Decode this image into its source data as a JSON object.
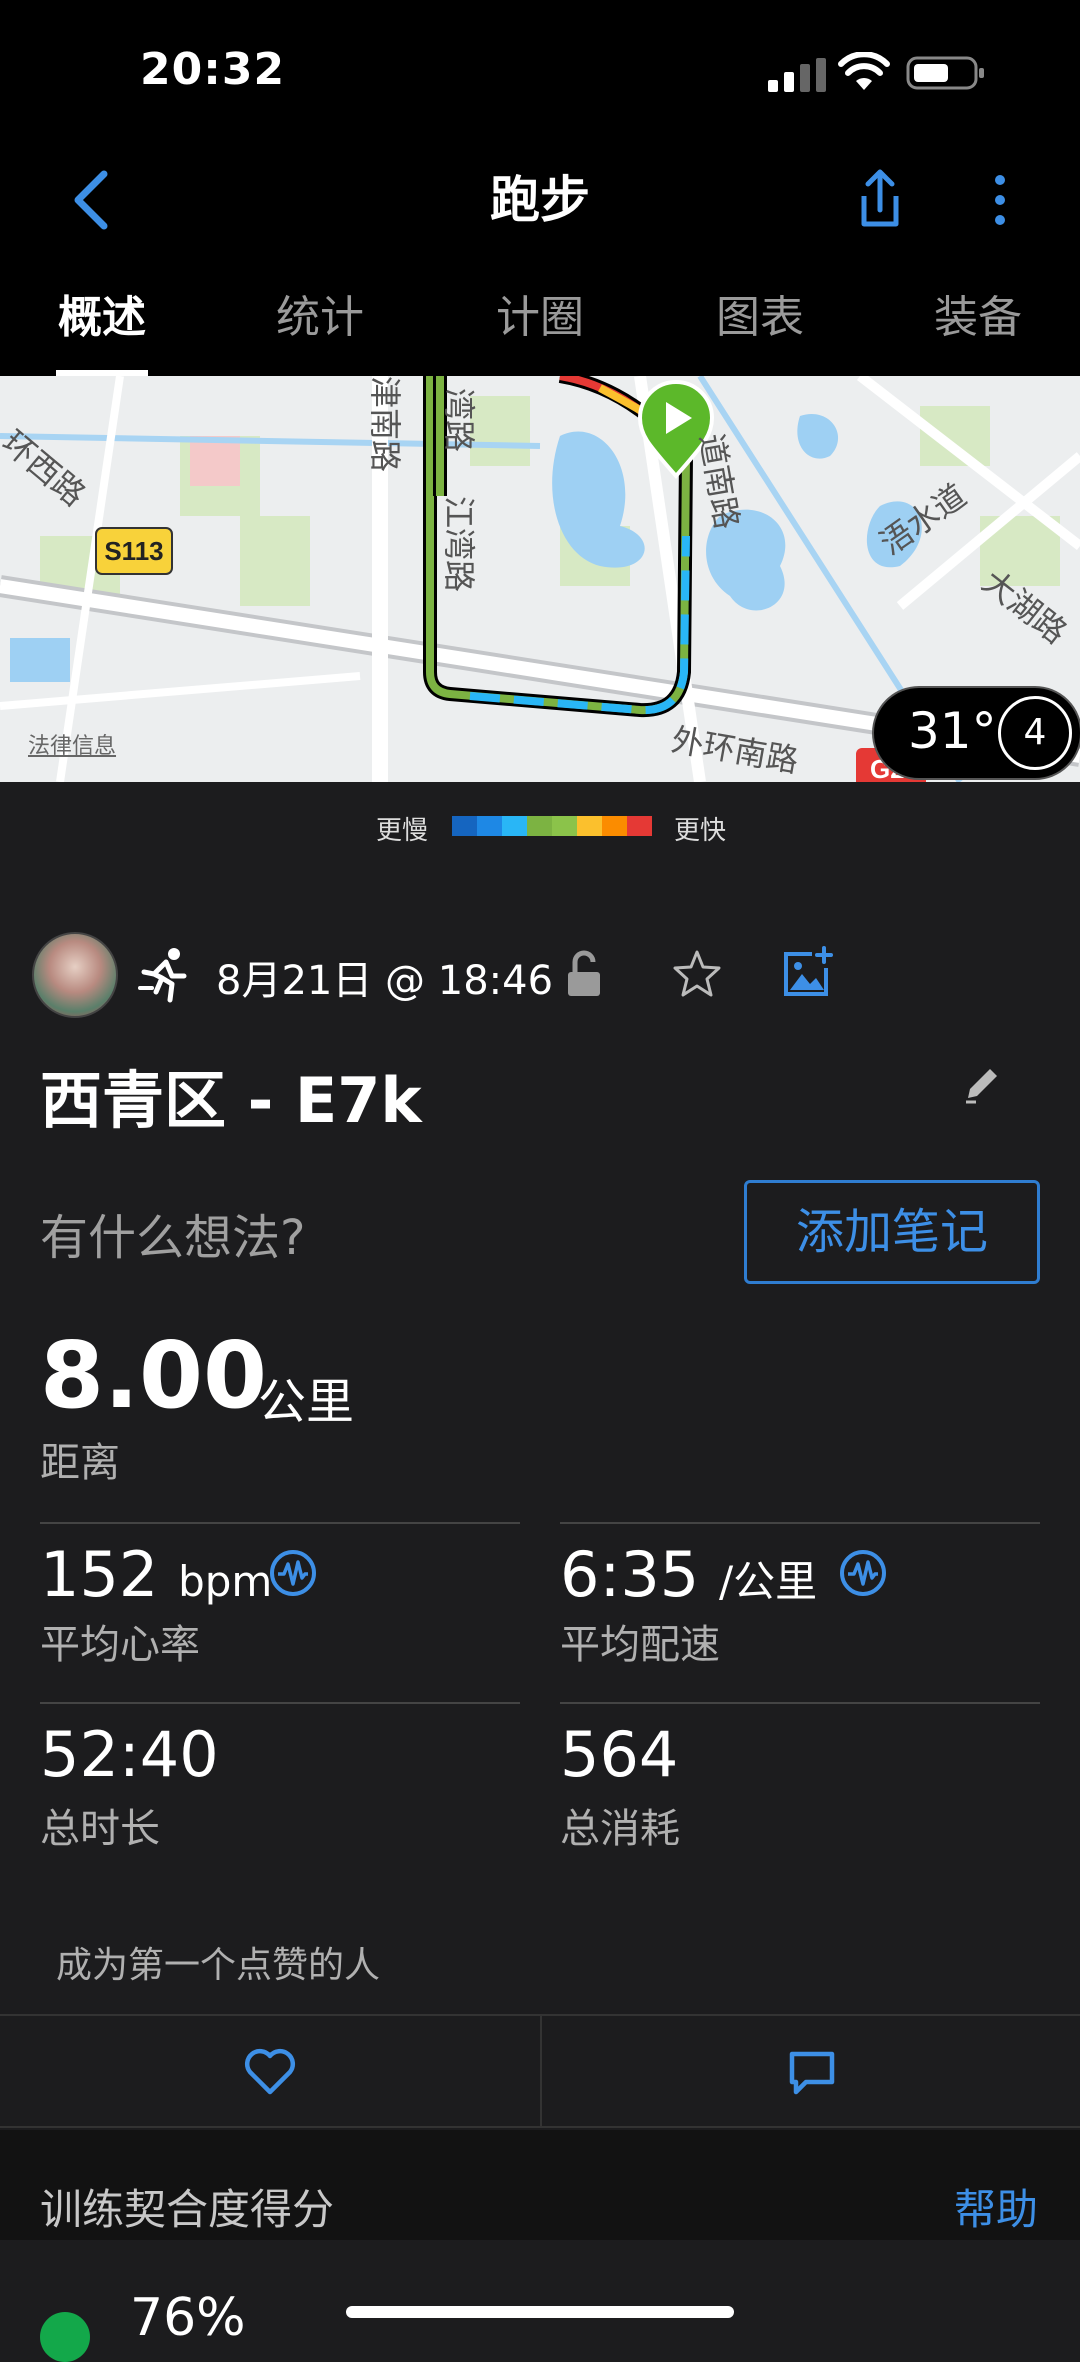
{
  "status_bar": {
    "time": "20:32"
  },
  "nav": {
    "title": "跑步",
    "back_icon": "chevron-left-icon",
    "share_icon": "share-icon",
    "more_icon": "more-vertical-icon"
  },
  "tabs": [
    {
      "label": "概述",
      "active": true
    },
    {
      "label": "统计",
      "active": false
    },
    {
      "label": "计圈",
      "active": false
    },
    {
      "label": "图表",
      "active": false
    },
    {
      "label": "装备",
      "active": false
    }
  ],
  "map": {
    "roads": [
      "津南路",
      "湾路",
      "江湾路",
      "道南路",
      "外环南路",
      "环西路",
      "浯水道",
      "大湖路",
      "S113",
      "G2"
    ],
    "legal": "法律信息",
    "temperature": "31°",
    "wind": "4"
  },
  "pace_legend": {
    "slow": "更慢",
    "fast": "更快",
    "colors": [
      "#1565c0",
      "#1e88e5",
      "#29b6f6",
      "#7cb342",
      "#8bc34a",
      "#fbc02d",
      "#fb8c00",
      "#e53935"
    ]
  },
  "activity": {
    "date": "8月21日 @ 18:46",
    "name": "西青区 - E7k",
    "thought_placeholder": "有什么想法?",
    "add_note": "添加笔记"
  },
  "stats": {
    "distance": {
      "value": "8.00",
      "unit": "公里",
      "label": "距离"
    },
    "heart_rate": {
      "value": "152",
      "unit": "bpm",
      "label": "平均心率"
    },
    "pace": {
      "value": "6:35",
      "unit": "/公里",
      "label": "平均配速"
    },
    "duration": {
      "value": "52:40",
      "label": "总时长"
    },
    "calories": {
      "value": "564",
      "label": "总消耗"
    }
  },
  "social": {
    "like_prompt": "成为第一个点赞的人"
  },
  "training": {
    "title": "训练契合度得分",
    "help": "帮助",
    "score": "76%",
    "accent": "#13a84a"
  },
  "accent_blue": "#3d8fe6"
}
